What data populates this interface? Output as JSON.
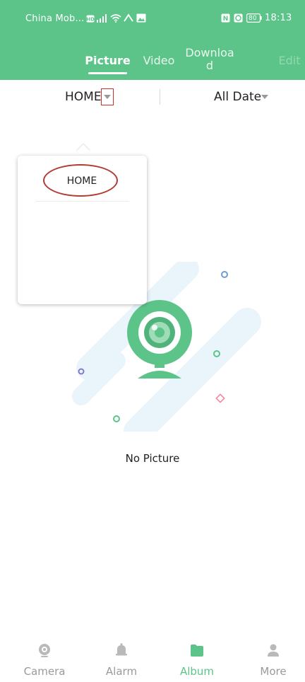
{
  "status_bar": {
    "carrier": "China Mob...",
    "time": "18:13",
    "battery": "80",
    "icons_left": [
      "hd-badge-icon",
      "signal-icon",
      "wifi-icon",
      "nfc-icon",
      "image-icon"
    ],
    "icons_right": [
      "nfc-status-icon",
      "alarm-status-icon",
      "battery-icon"
    ]
  },
  "tabs": {
    "picture": "Picture",
    "video": "Video",
    "download_line1": "Downloa",
    "download_line2": "d",
    "edit": "Edit",
    "active": "Picture"
  },
  "filters": {
    "device": "HOME",
    "date": "All Date"
  },
  "dropdown": {
    "options": [
      "HOME"
    ]
  },
  "empty_state": {
    "text": "No Picture",
    "icon": "webcam-illustration"
  },
  "bottom_nav": {
    "items": [
      {
        "label": "Camera",
        "icon": "camera-icon"
      },
      {
        "label": "Alarm",
        "icon": "bell-icon"
      },
      {
        "label": "Album",
        "icon": "folder-icon"
      },
      {
        "label": "More",
        "icon": "user-icon"
      }
    ],
    "active": "Album"
  },
  "colors": {
    "accent": "#5cc489",
    "annotation_red": "#c8302c",
    "inactive_gray": "#9a9a9a"
  }
}
